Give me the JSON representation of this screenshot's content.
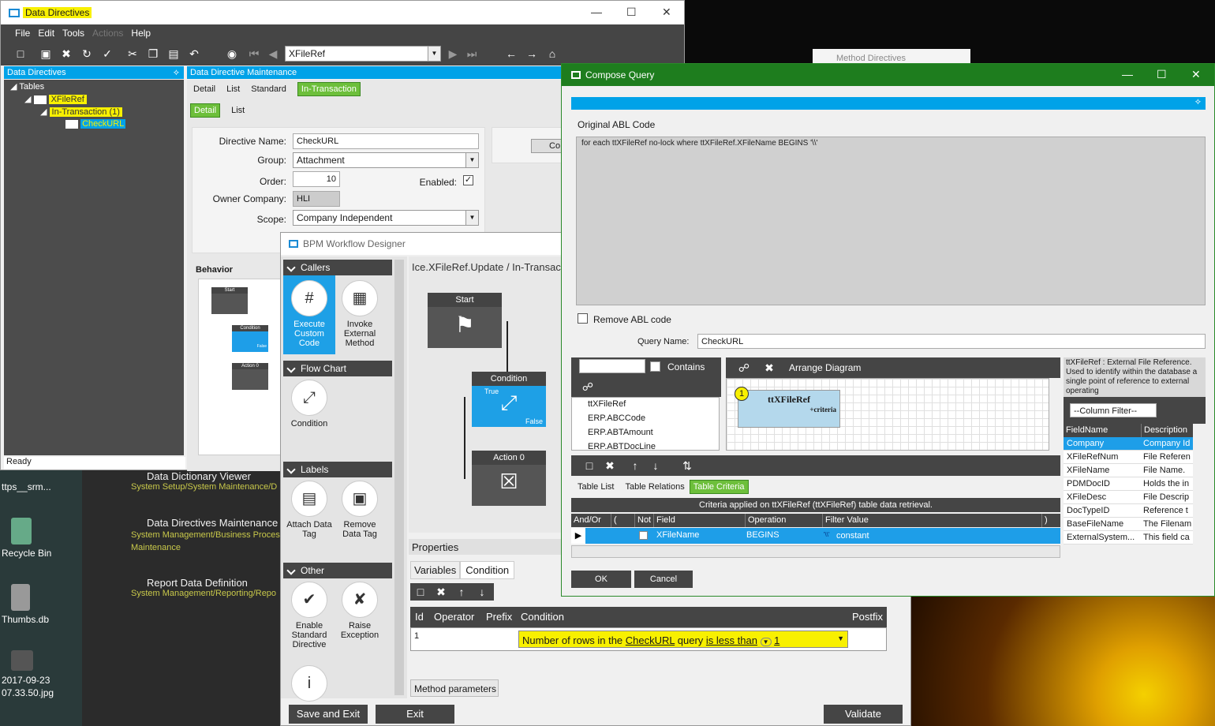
{
  "desktop": {
    "icons": [
      {
        "label": "ttps__srm..."
      },
      {
        "label": "Recycle Bin"
      },
      {
        "label": "Thumbs.db"
      },
      {
        "label": "2017-09-23 07.33.50.jpg"
      }
    ],
    "start_items": [
      {
        "title": "Data Dictionary Viewer",
        "sub": "System Setup/System Maintenance/D"
      },
      {
        "title": "Data Directives Maintenance",
        "sub": "System Management/Business Proces Maintenance"
      },
      {
        "title": "Report Data Definition",
        "sub": "System Management/Reporting/Repo"
      }
    ],
    "background_window_title": "Method Directives"
  },
  "dd_window": {
    "title": "Data Directives",
    "menu": [
      "File",
      "Edit",
      "Tools",
      "Actions",
      "Help"
    ],
    "search_value": "XFileRef",
    "left_panel_title": "Data Directives",
    "tree": {
      "root": "Tables",
      "table": "XFileRef",
      "group": "In-Transaction (1)",
      "directive": "CheckURL"
    },
    "status": "Ready",
    "right_panel_title": "Data Directive Maintenance",
    "tabs": [
      "Detail",
      "List",
      "Standard",
      "In-Transaction"
    ],
    "subtabs": [
      "Detail",
      "List"
    ],
    "form": {
      "directive_name_label": "Directive Name:",
      "directive_name": "CheckURL",
      "group_label": "Group:",
      "group": "Attachment",
      "order_label": "Order:",
      "order": "10",
      "enabled_label": "Enabled:",
      "owner_label": "Owner Company:",
      "owner": "HLI",
      "scope_label": "Scope:",
      "scope": "Company Independent"
    },
    "behavior_label": "Behavior",
    "co_button": "Co",
    "mini_nodes": {
      "start": "Start",
      "condition": "Condition",
      "action": "Action 0",
      "true": "True",
      "false": "False"
    }
  },
  "bpm": {
    "title": "BPM Workflow Designer",
    "sections": {
      "callers": "Callers",
      "flow": "Flow Chart",
      "labels": "Labels",
      "other": "Other"
    },
    "tools": {
      "execute": "Execute Custom Code",
      "invoke": "Invoke External Method",
      "condition": "Condition",
      "attach": "Attach Data Tag",
      "remove": "Remove Data Tag",
      "enable": "Enable Standard Directive",
      "raise": "Raise Exception"
    },
    "breadcrumb": "Ice.XFileRef.Update / In-Transacti",
    "nodes": {
      "start": "Start",
      "condition": "Condition",
      "action": "Action 0",
      "true": "True",
      "false": "False"
    },
    "properties_label": "Properties",
    "prop_tabs": [
      "Variables",
      "Condition"
    ],
    "cond_headers": [
      "Id",
      "Operator",
      "Prefix",
      "Condition",
      "Postfix"
    ],
    "cond_row_id": "1",
    "cond_text_a": "Number of rows in the ",
    "cond_text_link": "CheckURL",
    "cond_text_b": " query ",
    "cond_text_link2": "is less than",
    "cond_text_val": "1",
    "method_params": "Method parameters",
    "buttons": {
      "save": "Save and Exit",
      "exit": "Exit",
      "validate": "Validate"
    }
  },
  "cq": {
    "title": "Compose Query",
    "abl_label": "Original ABL Code",
    "abl_code": "for each ttXFileRef no-lock  where  ttXFileRef.XFileName BEGINS '\\\\'",
    "remove_abl": "Remove ABL code",
    "query_name_label": "Query Name:",
    "query_name": "CheckURL",
    "contains": "Contains",
    "arrange": "Arrange Diagram",
    "table_list": [
      "ttXFileRef",
      "ERP.ABCCode",
      "ERP.ABTAmount",
      "ERP.ABTDocLine"
    ],
    "diagram_table": "ttXFileRef",
    "diagram_criteria": "+criteria",
    "diagram_badge": "1",
    "desc": "ttXFileRef : External File Reference.     Used to identify within the database a single point  of  reference to external operating",
    "column_filter": "--Column Filter--",
    "field_headers": [
      "FieldName",
      "Description"
    ],
    "fields": [
      [
        "Company",
        "Company Id"
      ],
      [
        "XFileRefNum",
        "File Referen"
      ],
      [
        "XFileName",
        "File Name."
      ],
      [
        "PDMDocID",
        "Holds the in"
      ],
      [
        "XFileDesc",
        "File Descrip"
      ],
      [
        "DocTypeID",
        "Reference t"
      ],
      [
        "BaseFileName",
        "The Filenam"
      ],
      [
        "ExternalSystem...",
        "This field ca"
      ]
    ],
    "bottom_tabs": [
      "Table List",
      "Table Relations",
      "Table Criteria"
    ],
    "criteria_caption": "Criteria applied on ttXFileRef (ttXFileRef)  table data retrieval.",
    "crit_headers": [
      "And/Or",
      "(",
      "Not",
      "Field",
      "Operation",
      "Filter Value",
      ")"
    ],
    "crit_row": {
      "field": "XFileName",
      "operation": "BEGINS",
      "value_prefix": "'\\\\'",
      "value": "constant"
    },
    "ok": "OK",
    "cancel": "Cancel"
  }
}
